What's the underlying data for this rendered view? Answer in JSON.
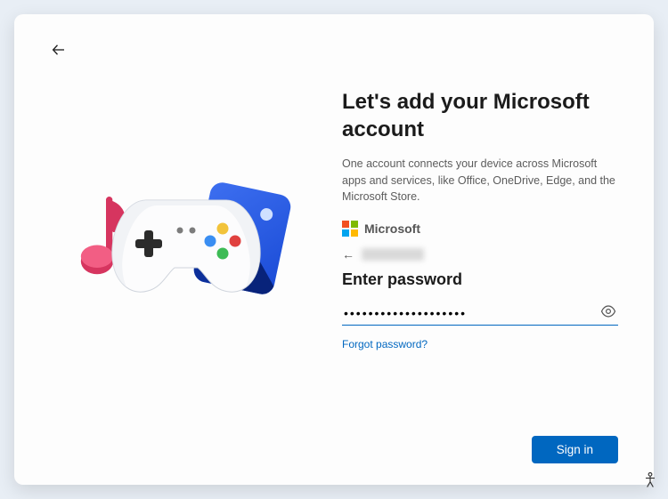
{
  "header": {
    "title": "Let's add your Microsoft account",
    "subtitle": "One account connects your device across Microsoft apps and services, like Office, OneDrive, Edge, and the Microsoft Store."
  },
  "brand": {
    "name": "Microsoft"
  },
  "signin": {
    "heading": "Enter password",
    "password_value": "••••••••••••••••••••",
    "forgot_label": "Forgot password?"
  },
  "footer": {
    "signin_label": "Sign in"
  },
  "colors": {
    "accent": "#0067c0"
  }
}
